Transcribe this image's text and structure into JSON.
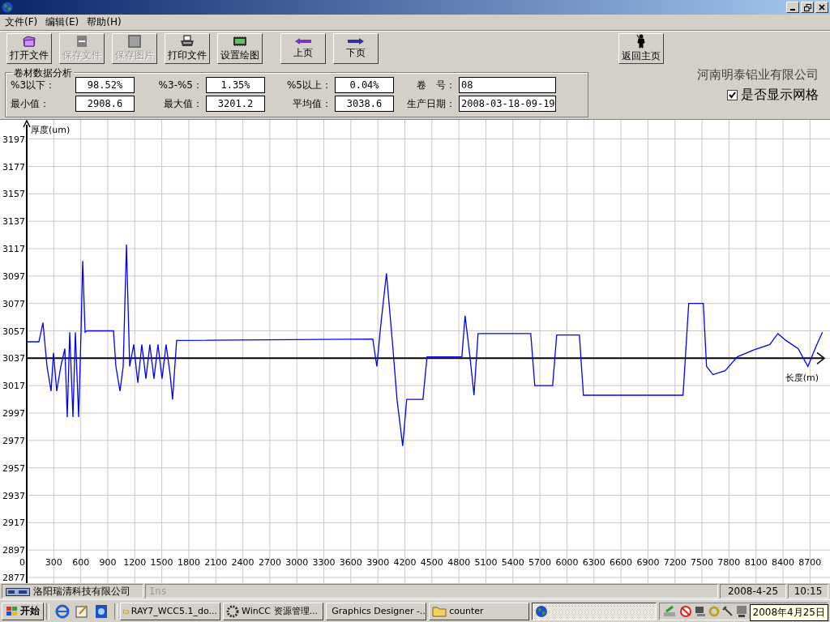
{
  "menu": [
    {
      "label": "文件(F)"
    },
    {
      "label": "编辑(E)"
    },
    {
      "label": "帮助(H)"
    }
  ],
  "toolbar": {
    "groups": [
      {
        "buttons": [
          {
            "label": "打开文件",
            "disabled": false
          },
          {
            "label": "保存文件",
            "disabled": true
          },
          {
            "label": "保存图片",
            "disabled": true
          },
          {
            "label": "打印文件",
            "disabled": false
          },
          {
            "label": "设置绘图",
            "disabled": false
          }
        ]
      },
      {
        "buttons": [
          {
            "label": "上页",
            "disabled": false
          },
          {
            "label": "下页",
            "disabled": false
          }
        ]
      },
      {
        "buttons": [
          {
            "label": "返回主页",
            "disabled": false
          }
        ]
      }
    ]
  },
  "analysis": {
    "title": "卷材数据分析",
    "rows": [
      [
        {
          "label": "%3以下：",
          "value": "98.52%"
        },
        {
          "label": "%3-%5：",
          "value": "1.35%"
        },
        {
          "label": "%5以上：",
          "value": "0.04%"
        },
        {
          "label": "卷　号：",
          "value": "08"
        }
      ],
      [
        {
          "label": "最小值：",
          "value": "2908.6"
        },
        {
          "label": "最大值：",
          "value": "3201.2"
        },
        {
          "label": "平均值：",
          "value": "3038.6"
        },
        {
          "label": "生产日期：",
          "value": "2008-03-18-09-19"
        }
      ]
    ]
  },
  "company": "河南明泰铝业有限公司",
  "show_grid": {
    "label": "是否显示网格",
    "checked": true
  },
  "chart_data": {
    "type": "line",
    "xlabel": "长度(m)",
    "ylabel": "厚度(um)",
    "x": [
      0,
      135,
      180,
      225,
      270,
      297,
      333,
      378,
      423,
      450,
      477,
      513,
      540,
      576,
      603,
      621,
      648,
      666,
      963,
      990,
      1035,
      1071,
      1107,
      1143,
      1188,
      1233,
      1278,
      1323,
      1368,
      1413,
      1458,
      1503,
      1548,
      1593,
      1620,
      1665,
      3843,
      3888,
      3933,
      3996,
      4068,
      4113,
      4176,
      4221,
      4401,
      4446,
      4833,
      4869,
      4923,
      4968,
      5013,
      5598,
      5643,
      5841,
      5886,
      6138,
      6183,
      7290,
      7353,
      7515,
      7551,
      7623,
      7758,
      7893,
      8073,
      8253,
      8343,
      8433,
      8568,
      8676,
      8775,
      8838
    ],
    "series": [
      {
        "color": "#0000ff",
        "values": [
          3049,
          3049,
          3063,
          3031,
          3013,
          3041,
          3013,
          3031,
          3044,
          2994,
          3056,
          2994,
          3056,
          2994,
          3056,
          3108,
          3056,
          3057,
          3057,
          3031,
          3013,
          3031,
          3120,
          3031,
          3047,
          3019,
          3047,
          3022,
          3047,
          3022,
          3047,
          3022,
          3047,
          3025,
          3007,
          3050,
          3051,
          3031,
          3062,
          3099,
          3044,
          3007,
          2973,
          3007,
          3007,
          3038,
          3038,
          3068,
          3038,
          3010,
          3055,
          3055,
          3017,
          3017,
          3054,
          3054,
          3010,
          3010,
          3077,
          3077,
          3031,
          3025,
          3028,
          3038,
          3043,
          3047,
          3055,
          3050,
          3044,
          3031,
          3047,
          3056
        ]
      }
    ],
    "xlim": [
      0,
      8850
    ],
    "ylim": [
      2877,
      3211
    ],
    "xticks": [
      0,
      300,
      600,
      900,
      1200,
      1500,
      1800,
      2100,
      2400,
      2700,
      3000,
      3300,
      3600,
      3900,
      4200,
      4500,
      4800,
      5100,
      5400,
      5700,
      6000,
      6300,
      6600,
      6900,
      7200,
      7500,
      7800,
      8100,
      8400,
      8700
    ],
    "yticks": [
      2877,
      2897,
      2917,
      2937,
      2957,
      2977,
      2997,
      3017,
      3037,
      3057,
      3077,
      3097,
      3117,
      3137,
      3157,
      3177,
      3197
    ],
    "ref_lines": [
      {
        "axis": "y",
        "value": 3037
      }
    ],
    "grid": true
  },
  "status_bar": {
    "company": "洛阳瑞清科技有限公司",
    "mode": "Ins",
    "date": "2008-4-25",
    "time": "10:15"
  },
  "taskbar": {
    "start": "开始",
    "tasks": [
      {
        "label": "RAY7_WCC5.1_do...",
        "selected": false
      },
      {
        "label": "WinCC 资源管理...",
        "selected": false
      },
      {
        "label": "Graphics Designer -...",
        "selected": false
      },
      {
        "label": "counter",
        "selected": false
      },
      {
        "selected": true
      }
    ],
    "tooltip": "2008年4月25日"
  }
}
